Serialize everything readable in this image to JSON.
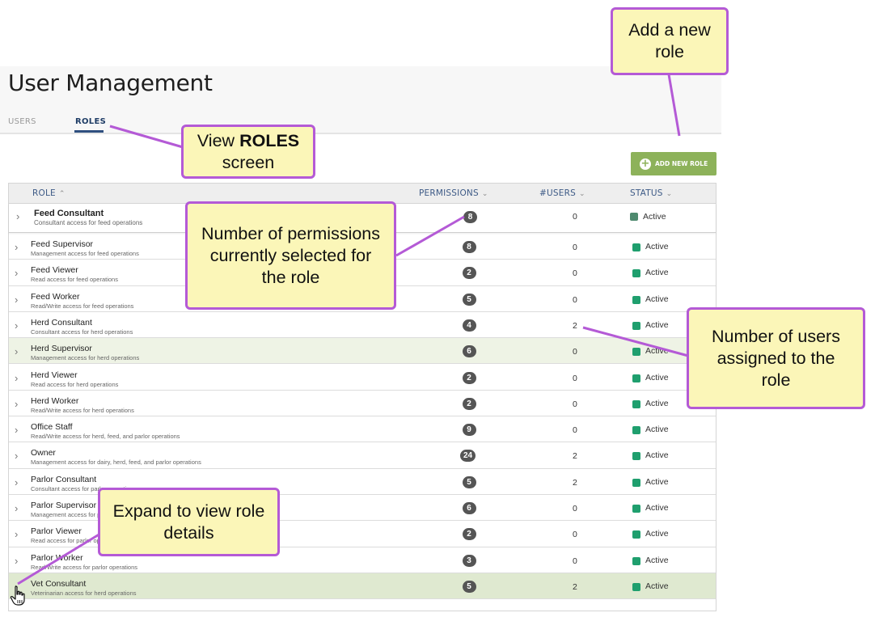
{
  "page": {
    "title": "User Management"
  },
  "tabs": [
    {
      "label": "USERS",
      "active": false
    },
    {
      "label": "ROLES",
      "active": true
    }
  ],
  "toolbar": {
    "add_role_label": "ADD NEW ROLE"
  },
  "table": {
    "columns": {
      "role": "ROLE",
      "permissions": "PERMISSIONS",
      "users": "#USERS",
      "status": "STATUS"
    },
    "rows": [
      {
        "name": "Feed Consultant",
        "description": "Consultant access for feed operations",
        "permissions": "8",
        "users": "0",
        "status": "Active"
      },
      {
        "name": "Feed Supervisor",
        "description": "Management access for feed operations",
        "permissions": "8",
        "users": "0",
        "status": "Active"
      },
      {
        "name": "Feed Viewer",
        "description": "Read access for feed operations",
        "permissions": "2",
        "users": "0",
        "status": "Active"
      },
      {
        "name": "Feed Worker",
        "description": "Read/Write access for feed operations",
        "permissions": "5",
        "users": "0",
        "status": "Active"
      },
      {
        "name": "Herd Consultant",
        "description": "Consultant access for herd operations",
        "permissions": "4",
        "users": "2",
        "status": "Active"
      },
      {
        "name": "Herd Supervisor",
        "description": "Management access for herd operations",
        "permissions": "6",
        "users": "0",
        "status": "Active"
      },
      {
        "name": "Herd Viewer",
        "description": "Read access for herd operations",
        "permissions": "2",
        "users": "0",
        "status": "Active"
      },
      {
        "name": "Herd Worker",
        "description": "Read/Write access for herd operations",
        "permissions": "2",
        "users": "0",
        "status": "Active"
      },
      {
        "name": "Office Staff",
        "description": "Read/Write access for herd, feed, and parlor operations",
        "permissions": "9",
        "users": "0",
        "status": "Active"
      },
      {
        "name": "Owner",
        "description": "Management access for dairy, herd, feed, and parlor operations",
        "permissions": "24",
        "users": "2",
        "status": "Active"
      },
      {
        "name": "Parlor Consultant",
        "description": "Consultant access for parlor operations",
        "permissions": "5",
        "users": "2",
        "status": "Active"
      },
      {
        "name": "Parlor Supervisor",
        "description": "Management access for parlor operations",
        "permissions": "6",
        "users": "0",
        "status": "Active"
      },
      {
        "name": "Parlor Viewer",
        "description": "Read access for parlor operations",
        "permissions": "2",
        "users": "0",
        "status": "Active"
      },
      {
        "name": "Parlor Worker",
        "description": "Read/Write access for parlor operations",
        "permissions": "3",
        "users": "0",
        "status": "Active"
      },
      {
        "name": "Vet Consultant",
        "description": "Veterinarian access for herd operations",
        "permissions": "5",
        "users": "2",
        "status": "Active"
      }
    ]
  },
  "callouts": {
    "add_role": "Add a new role",
    "roles_screen_prefix": "View",
    "roles_screen_bold": "ROLES",
    "roles_screen_suffix": "screen",
    "permissions": "Number of permissions currently selected for the role",
    "users": "Number of users assigned to the role",
    "expand": "Expand to view role details"
  },
  "colors": {
    "accent_green": "#8db25a",
    "status_active": "#1f9f6e",
    "callout_fill": "#fbf6b8",
    "callout_border": "#b45ad6",
    "tab_active": "#2f4f7f"
  },
  "icons": {
    "add": "plus-circle-icon",
    "row_expand": "chevron-right-icon",
    "sort_asc": "caret-up-icon",
    "sort": "caret-down-icon",
    "cursor": "hand-pointer-icon"
  }
}
